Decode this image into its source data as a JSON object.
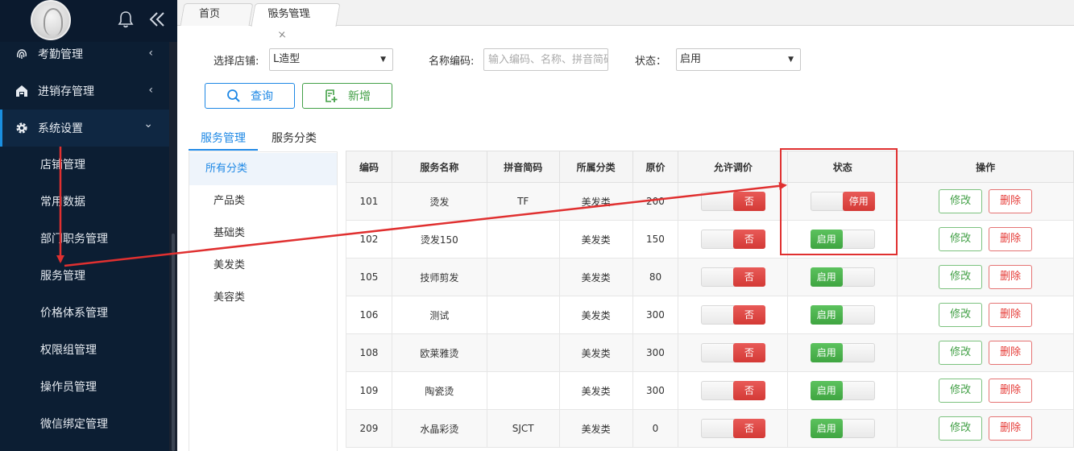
{
  "sidebar": {
    "icons": {
      "bell": "bell-icon",
      "collapse": "double-chevron-left-icon"
    },
    "menu": [
      {
        "label": "考勤管理",
        "icon": "fingerprint-icon",
        "chevron": "‹"
      },
      {
        "label": "进销存管理",
        "icon": "warehouse-icon",
        "chevron": "‹"
      },
      {
        "label": "系统设置",
        "icon": "gear-icon",
        "chevron": "⌄"
      }
    ],
    "sub_items": [
      "店铺管理",
      "常用数据",
      "部门职务管理",
      "服务管理",
      "价格体系管理",
      "权限组管理",
      "操作员管理",
      "微信绑定管理"
    ]
  },
  "tabs": [
    {
      "label": "首页"
    },
    {
      "label": "服务管理",
      "close": "×"
    }
  ],
  "filters": {
    "store_label": "选择店铺:",
    "store_value": "L造型",
    "code_label": "名称编码:",
    "code_placeholder": "输入编码、名称、拼音简码",
    "status_label": "状态：",
    "status_value": "启用",
    "query_label": "查询",
    "add_label": "新增"
  },
  "category_tabs": [
    "服务管理",
    "服务分类"
  ],
  "categories": [
    "所有分类",
    "产品类",
    "基础类",
    "美发类",
    "美容类"
  ],
  "table": {
    "headers": [
      "编码",
      "服务名称",
      "拼音简码",
      "所属分类",
      "原价",
      "允许调价",
      "状态",
      "操作"
    ],
    "rows": [
      {
        "code": "101",
        "name": "烫发",
        "pinyin": "TF",
        "category": "美发类",
        "price": "200",
        "adjust": "否",
        "status": "停用",
        "status_on": false
      },
      {
        "code": "102",
        "name": "烫发150",
        "pinyin": "",
        "category": "美发类",
        "price": "150",
        "adjust": "否",
        "status": "启用",
        "status_on": true
      },
      {
        "code": "105",
        "name": "技师剪发",
        "pinyin": "",
        "category": "美发类",
        "price": "80",
        "adjust": "否",
        "status": "启用",
        "status_on": true
      },
      {
        "code": "106",
        "name": "测试",
        "pinyin": "",
        "category": "美发类",
        "price": "300",
        "adjust": "否",
        "status": "启用",
        "status_on": true
      },
      {
        "code": "108",
        "name": "欧莱雅烫",
        "pinyin": "",
        "category": "美发类",
        "price": "300",
        "adjust": "否",
        "status": "启用",
        "status_on": true
      },
      {
        "code": "109",
        "name": "陶瓷烫",
        "pinyin": "",
        "category": "美发类",
        "price": "300",
        "adjust": "否",
        "status": "启用",
        "status_on": true
      },
      {
        "code": "209",
        "name": "水晶彩烫",
        "pinyin": "SJCT",
        "category": "美发类",
        "price": "0",
        "adjust": "否",
        "status": "启用",
        "status_on": true
      }
    ],
    "edit_label": "修改",
    "delete_label": "删除"
  },
  "colors": {
    "accent": "#1e88e5",
    "success": "#43a047",
    "danger": "#e53935",
    "sidebar": "#0c1e33",
    "annotation": "#e03030"
  }
}
